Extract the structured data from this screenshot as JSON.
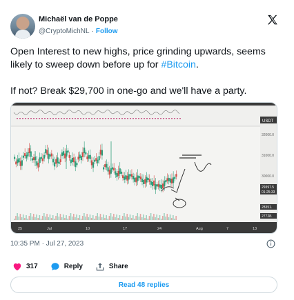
{
  "author": {
    "display_name": "Michaël van de Poppe",
    "handle": "@CryptoMichNL",
    "separator": "·",
    "follow_label": "Follow"
  },
  "tweet": {
    "paragraph_1_text": "Open Interest to new highs, price grinding upwards, seems likely to sweep down before up for ",
    "hashtag": "#Bitcoin",
    "paragraph_1_end": ".",
    "paragraph_2": "If not? Break $29,700 in one-go and we'll have a party."
  },
  "chart_image": {
    "price_axis_ticks": [
      "32000.0",
      "31000.0",
      "30000.0"
    ],
    "price_labels": [
      "29397.5",
      "01:25:33",
      "28351.",
      "27728."
    ],
    "badge": "USDT",
    "date_ticks": [
      "25",
      "Jul",
      "10",
      "17",
      "24",
      "Aug",
      "7",
      "13"
    ],
    "colors": {
      "up": "#2e9e7a",
      "down": "#d44f4a",
      "oi_line": "#c85a8a",
      "annotation": "#333333"
    }
  },
  "meta": {
    "timestamp": "10:35 PM · Jul 27, 2023"
  },
  "actions": {
    "likes_count": "317",
    "reply_label": "Reply",
    "share_label": "Share",
    "like_color": "#f91880",
    "reply_color": "#1d9bf0"
  },
  "read_replies_label": "Read 48 replies"
}
